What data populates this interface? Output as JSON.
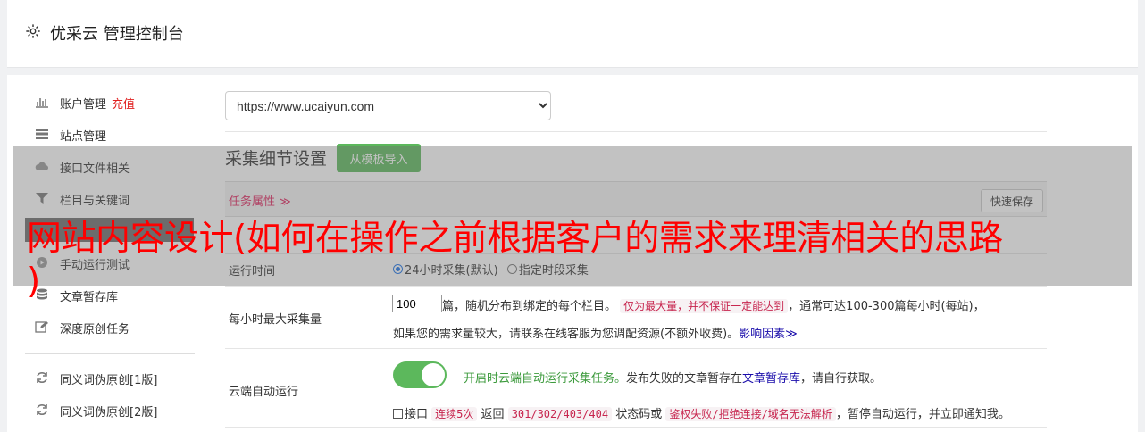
{
  "header": {
    "title": "优采云 管理控制台",
    "icon": "gear-icon"
  },
  "sidebar": {
    "items": [
      {
        "label": "账户管理",
        "extra": "充值",
        "icon": "bar-chart-icon"
      },
      {
        "label": "站点管理",
        "icon": "server-icon"
      },
      {
        "label": "接口文件相关",
        "icon": "cloud-upload-icon"
      },
      {
        "label": "栏目与关键词",
        "icon": "filter-icon"
      },
      {
        "label": "",
        "icon": ""
      },
      {
        "label": "手动运行测试",
        "icon": "play-icon"
      },
      {
        "label": "文章暂存库",
        "icon": "database-icon"
      },
      {
        "label": "深度原创任务",
        "icon": "edit-icon"
      },
      {
        "label": "同义词伪原创[1版]",
        "icon": "refresh-icon"
      },
      {
        "label": "同义词伪原创[2版]",
        "icon": "refresh-icon"
      }
    ]
  },
  "site_select": {
    "value": "https://www.ucaiyun.com"
  },
  "section": {
    "title": "采集细节设置",
    "import_button": "从模板导入"
  },
  "task": {
    "label": "任务属性 ≫",
    "save_button": "快速保存"
  },
  "run_time": {
    "label": "运行时间",
    "options": [
      "24小时采集(默认)",
      "指定时段采集"
    ],
    "selected": "24小时采集(默认)"
  },
  "max_per_hour": {
    "label": "每小时最大采集量",
    "value": "100",
    "text1": "篇，随机分布到绑定的每个栏目。",
    "code1": "仅为最大量，并不保证一定能达到",
    "text2": "，通常可达100-300篇每小时(每站)，",
    "text3": "如果您的需求量较大，请联系在线客服为您调配资源(不额外收费)。",
    "link": "影响因素≫"
  },
  "cloud_run": {
    "label": "云端自动运行",
    "toggle_on": true,
    "green_text": "开启时云端自动运行采集任务。",
    "text1": "发布失败的文章暂存在",
    "link": "文章暂存库",
    "text2": "，请自行获取。",
    "chk_label": "接口",
    "code1": "连续5次",
    "text3": "返回",
    "code2": "301/302/403/404",
    "text4": "状态码或",
    "code3": "鉴权失败/拒绝连接/域名无法解析",
    "text5": "，暂停自动运行，并立即通知我。"
  },
  "watermark": {
    "line1": "网站内容设计(如何在操作之前根据客户的需求来理清相关的思路",
    "line2": ")"
  },
  "colors": {
    "green": "#5cb85c",
    "red": "#e02020",
    "pink": "#c7254e",
    "watermark": "#ff0000"
  }
}
